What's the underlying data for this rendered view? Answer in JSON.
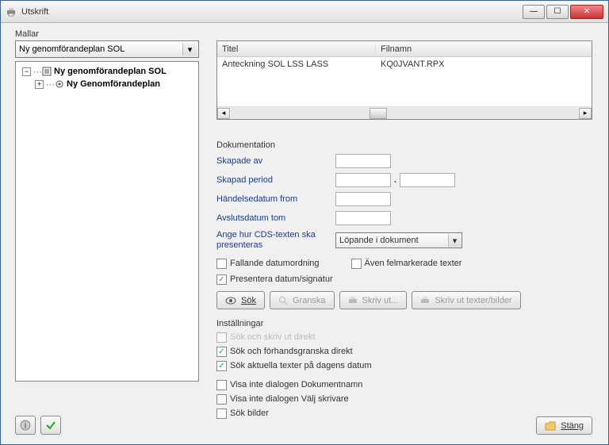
{
  "window": {
    "title": "Utskrift"
  },
  "left": {
    "label": "Mallar",
    "combo": "Ny genomförandeplan SOL",
    "tree": {
      "node1": "Ny genomförandeplan SOL",
      "node2": "Ny Genomförandeplan"
    }
  },
  "grid": {
    "headers": {
      "titel": "Titel",
      "filnamn": "Filnamn"
    },
    "row1": {
      "titel": "Anteckning SOL LSS LASS",
      "filnamn": "KQ0JVANT.RPX"
    }
  },
  "doc": {
    "title": "Dokumentation",
    "skapade_av": "Skapade av",
    "skapad_period": "Skapad period",
    "handelsedatum": "Händelsedatum from",
    "avslutsdatum": "Avslutsdatum tom",
    "cds_label": "Ange hur CDS-texten ska presenteras",
    "cds_value": "Löpande i dokument",
    "fallande": "Fallande datumordning",
    "aven_fel": "Även felmarkerade texter",
    "presentera": "Presentera datum/signatur",
    "sok": "Sök",
    "granska": "Granska",
    "skriv_ut": "Skriv ut...",
    "skriv_bilder": "Skriv ut texter/bilder"
  },
  "inst": {
    "title": "Inställningar",
    "c1": "Sök och skriv ut direkt",
    "c2": "Sök och förhandsgranska direkt",
    "c3": "Sök aktuella texter på dagens datum",
    "c4": "Visa inte dialogen Dokumentnamn",
    "c5": "Visa inte dialogen Välj skrivare",
    "c6": "Sök bilder"
  },
  "close_btn": "Stäng"
}
